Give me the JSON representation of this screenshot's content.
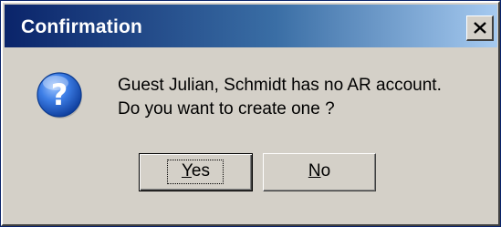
{
  "window": {
    "title": "Confirmation",
    "close_symbol": "×"
  },
  "message": {
    "icon": "question-icon",
    "line1": "Guest Julian, Schmidt has no AR account.",
    "line2": "Do you want to create one ?"
  },
  "buttons": {
    "yes": {
      "mnemonic": "Y",
      "rest": "es",
      "label": "Yes"
    },
    "no": {
      "mnemonic": "N",
      "rest": "o",
      "label": "No"
    }
  },
  "colors": {
    "titlebar_start": "#0a246a",
    "titlebar_end": "#a6caf0",
    "face": "#d4d0c8",
    "icon_blue": "#1d5fcf"
  }
}
